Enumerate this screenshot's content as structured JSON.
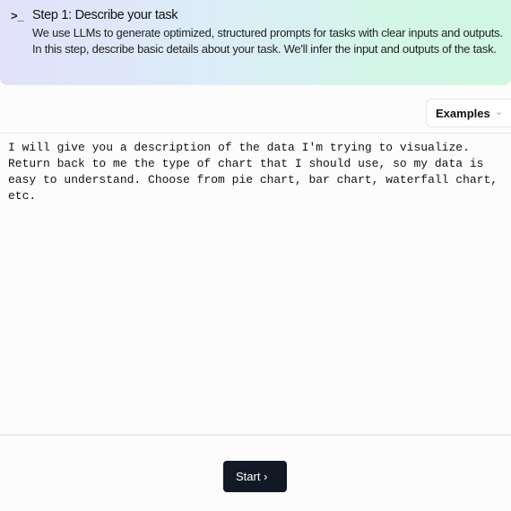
{
  "header": {
    "icon": "terminal-icon",
    "title": "Step 1: Describe your task",
    "description": "We use LLMs to generate optimized, structured prompts for tasks with clear inputs and outputs. In this step, describe basic details about your task. We'll infer the input and outputs of the task."
  },
  "examples": {
    "label": "Examples",
    "icon": "chevron-down-icon"
  },
  "task_input": {
    "value": "I will give you a description of the data I'm trying to visualize. Return back to me the type of chart that I should use, so my data is easy to understand. Choose from pie chart, bar chart, waterfall chart, etc."
  },
  "footer": {
    "start_label": "Start",
    "start_icon": "chevron-right-icon"
  }
}
